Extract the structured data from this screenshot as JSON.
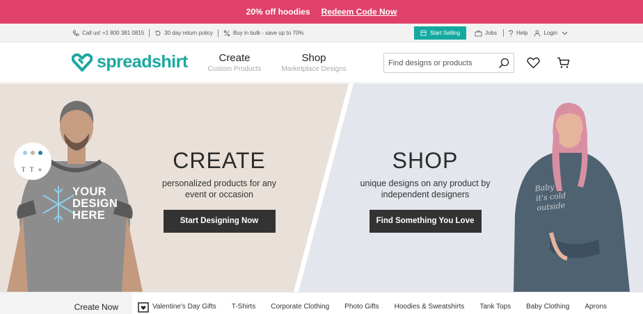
{
  "promo": {
    "headline": "20% off hoodies",
    "link": "Redeem Code Now"
  },
  "utility": {
    "phone": "Call us! +1 800 381 0815",
    "returns": "30 day return policy",
    "bulk": "Buy in bulk - save up to 70%",
    "start_selling": "Start Selling",
    "jobs": "Jobs",
    "help": "Help",
    "login": "Login"
  },
  "header": {
    "logo": "spreadshirt",
    "nav": [
      {
        "title": "Create",
        "subtitle": "Custom Products"
      },
      {
        "title": "Shop",
        "subtitle": "Marketplace Designs"
      }
    ],
    "search_placeholder": "Find designs or products"
  },
  "hero": {
    "create": {
      "heading": "CREATE",
      "line1": "personalized products for any",
      "line2": "event or occasion",
      "button": "Start Designing Now"
    },
    "shop": {
      "heading": "SHOP",
      "line1": "unique designs on any product by",
      "line2": "independent designers",
      "button": "Find Something You Love"
    },
    "tshirt_print": [
      "YOUR",
      "DESIGN",
      "HERE"
    ],
    "hoodie_print": [
      "Baby",
      "it's cold",
      "outside"
    ]
  },
  "categories": {
    "create_now": "Create Now",
    "items": [
      "Valentine's Day Gifts",
      "T-Shirts",
      "Corporate Clothing",
      "Photo Gifts",
      "Hoodies & Sweatshirts",
      "Tank Tops",
      "Baby Clothing",
      "Aprons"
    ]
  },
  "colors": {
    "promo": "#e0416a",
    "brand": "#1aa8a0",
    "button": "#333333"
  }
}
